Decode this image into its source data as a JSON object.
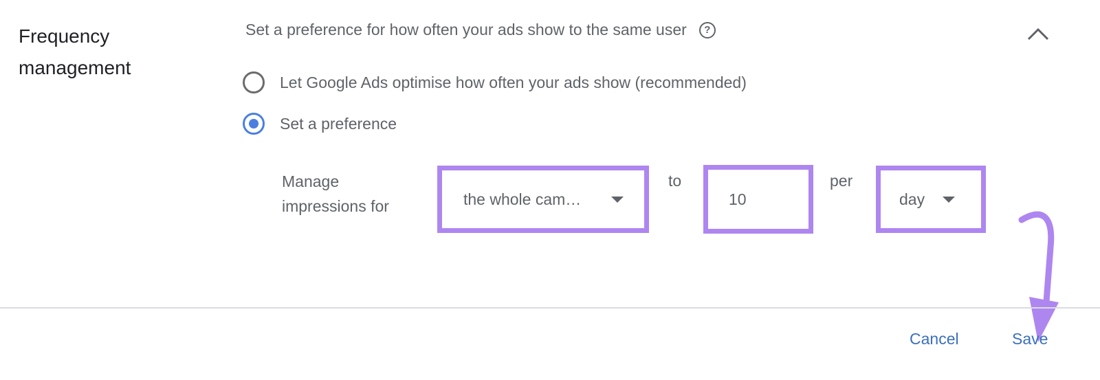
{
  "section": {
    "title_line1": "Frequency",
    "title_line2": "management",
    "description": "Set a preference for how often your ads show to the same user",
    "help_icon": "help-circle-icon",
    "collapse_icon": "chevron-up-icon"
  },
  "options": [
    {
      "label": "Let Google Ads optimise how often your ads show (recommended)",
      "selected": false
    },
    {
      "label": "Set a preference",
      "selected": true
    }
  ],
  "preference": {
    "manage_label_line1": "Manage",
    "manage_label_line2": "impressions for",
    "scope_value": "the whole cam…",
    "to_label": "to",
    "count_value": "10",
    "per_label": "per",
    "period_value": "day"
  },
  "footer": {
    "cancel_label": "Cancel",
    "save_label": "Save"
  },
  "colors": {
    "highlight": "#ae86f0",
    "accent": "#4a7fe0",
    "link": "#3b6fc0"
  }
}
